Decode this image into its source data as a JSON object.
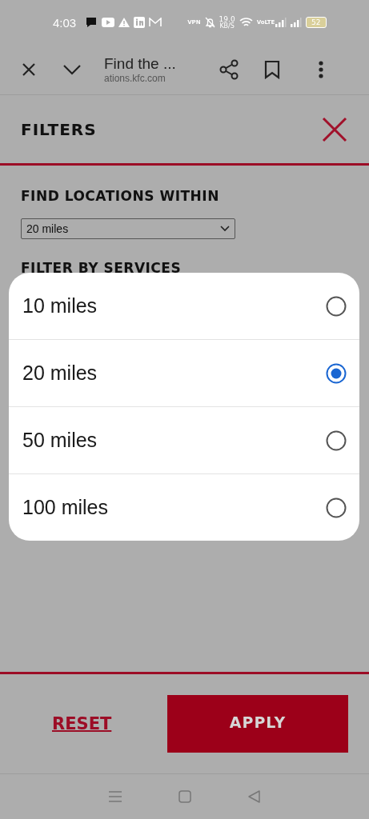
{
  "status_bar": {
    "time": "4:03",
    "vpn": "VPN",
    "net_speed": "19.0",
    "net_unit": "KB/S",
    "volte": "VoLTE",
    "battery": "52"
  },
  "browser_bar": {
    "title": "Find the ...",
    "url": "ations.kfc.com"
  },
  "filters": {
    "title": "FILTERS",
    "distance_label": "FIND LOCATIONS WITHIN",
    "distance_value": "20 miles",
    "services_label": "FILTER BY SERVICES"
  },
  "picker": {
    "options": [
      {
        "label": "10 miles",
        "selected": false
      },
      {
        "label": "20 miles",
        "selected": true
      },
      {
        "label": "50 miles",
        "selected": false
      },
      {
        "label": "100 miles",
        "selected": false
      }
    ]
  },
  "footer": {
    "reset": "RESET",
    "apply": "APPLY"
  }
}
